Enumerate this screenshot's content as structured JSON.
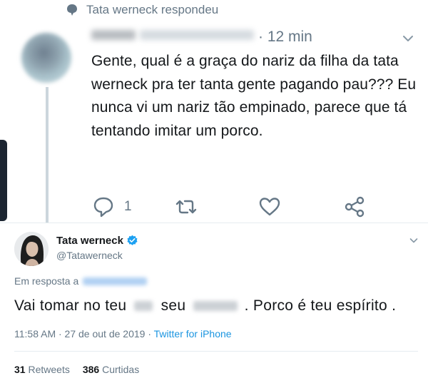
{
  "reply_tweet": {
    "social_context": "Tata werneck respondeu",
    "time": "· 12 min",
    "text": "Gente, qual é a graça do nariz da filha da tata werneck pra ter tanta gente pagando pau??? Eu nunca vi um nariz tão empinado, parece que tá tentando imitar um porco.",
    "reply_count": "1",
    "icons": [
      "comment-icon",
      "chat-bubble-icon",
      "retweet-icon",
      "heart-icon",
      "share-icon",
      "chevron-down-icon"
    ]
  },
  "main_tweet": {
    "name": "Tata werneck",
    "handle": "@Tatawerneck",
    "reply_to_label": "Em resposta a",
    "text_part1": "Vai tomar no teu",
    "text_part2": "seu",
    "text_part3": ". Porco é teu espírito .",
    "meta_time": "11:58 AM · 27 de out de 2019 · ",
    "meta_source": "Twitter for iPhone",
    "retweets_count": "31",
    "retweets_label": "Retweets",
    "likes_count": "386",
    "likes_label": "Curtidas",
    "icons": [
      "verified-badge-icon",
      "chevron-down-icon"
    ]
  },
  "colors": {
    "text": "#14171a",
    "secondary": "#657786",
    "link": "#1b95e0",
    "verified": "#1da1f2",
    "border": "#e6ecf0"
  }
}
